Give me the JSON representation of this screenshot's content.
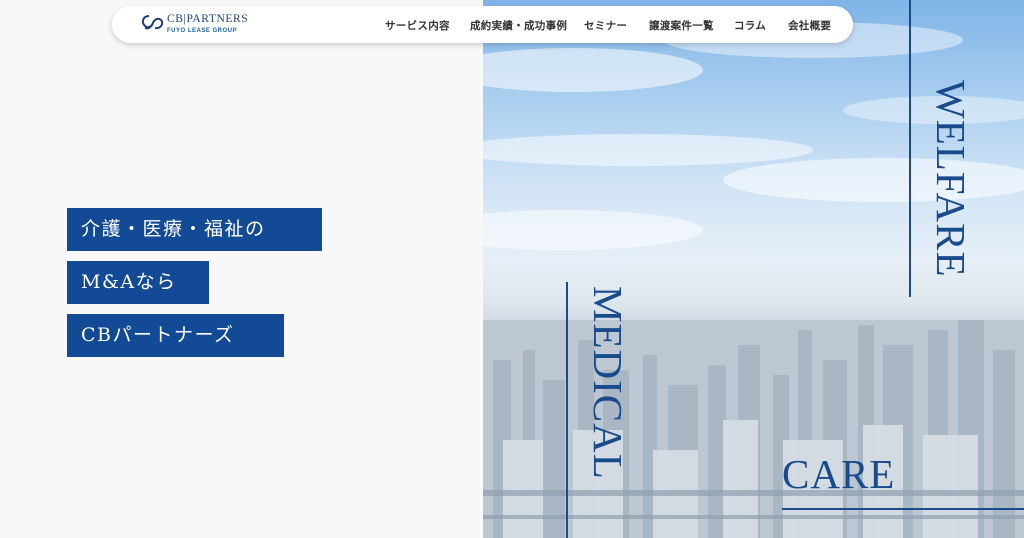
{
  "header": {
    "logo": {
      "brand": "CB|PARTNERS",
      "group": "FUYO LEASE GROUP",
      "mark_icon": "cb-logo-mark-icon"
    },
    "nav": [
      {
        "label": "サービス内容"
      },
      {
        "label": "成約実績・成功事例"
      },
      {
        "label": "セミナー"
      },
      {
        "label": "譲渡案件一覧"
      },
      {
        "label": "コラム"
      },
      {
        "label": "会社概要"
      }
    ]
  },
  "hero": {
    "headline": [
      "介護・医療・福祉の",
      "M&Aなら",
      "CBパートナーズ"
    ],
    "words": {
      "welfare": "WELFARE",
      "medical": "MEDICAL",
      "care": "CARE"
    }
  },
  "colors": {
    "brand": "#124a95",
    "accent_text": "#184a8c",
    "page_bg": "#f8f8f9"
  }
}
